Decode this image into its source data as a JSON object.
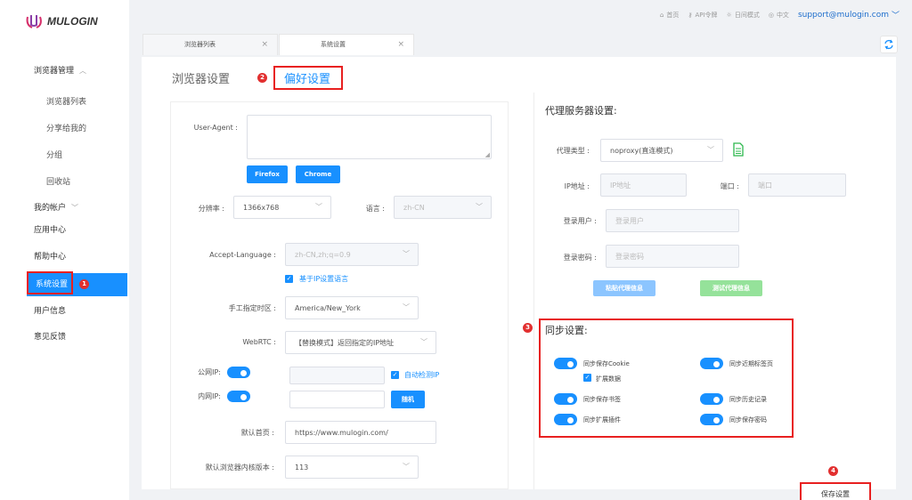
{
  "app": {
    "logo_text": "MULOGIN"
  },
  "topbar": {
    "home": "首页",
    "api": "API令牌",
    "theme": "日间模式",
    "lang": "中文",
    "email": "support@mulogin.com"
  },
  "sidebar": {
    "browser_mgmt": "浏览器管理",
    "browser_list": "浏览器列表",
    "shared": "分享给我的",
    "group": "分组",
    "recycle": "回收站",
    "my_account": "我的帐户",
    "app_center": "应用中心",
    "help_center": "帮助中心",
    "system_settings": "系统设置",
    "user_info": "用户信息",
    "feedback": "意见反馈"
  },
  "tabs": {
    "browser_list": "浏览器列表",
    "system_settings": "系统设置"
  },
  "settings_tabs": {
    "browser_settings": "浏览器设置",
    "preferences": "偏好设置"
  },
  "browser_form": {
    "user_agent_label": "User-Agent :",
    "firefox_btn": "Firefox",
    "chrome_btn": "Chrome",
    "resolution_label": "分辨率 :",
    "resolution_value": "1366x768",
    "language_label": "语言 :",
    "language_value": "zh-CN",
    "accept_lang_label": "Accept-Language :",
    "accept_lang_value": "zh-CN,zh;q=0.9",
    "ip_lang_checkbox": "基于IP设置语言",
    "timezone_label": "手工指定时区 :",
    "timezone_value": "America/New_York",
    "webrtc_label": "WebRTC :",
    "webrtc_value": "【替换模式】返回指定的IP地址",
    "public_ip_label": "公网IP:",
    "auto_detect_ip": "自动检测IP",
    "private_ip_label": "内网IP:",
    "random_btn": "随机",
    "homepage_label": "默认首页 :",
    "homepage_value": "https://www.mulogin.com/",
    "kernel_label": "默认浏览器内核版本 :",
    "kernel_value": "113"
  },
  "proxy": {
    "title": "代理服务器设置:",
    "type_label": "代理类型 :",
    "type_value": "noproxy(直连模式)",
    "ip_label": "IP地址 :",
    "ip_placeholder": "IP地址",
    "port_label": "端口 :",
    "port_placeholder": "端口",
    "user_label": "登录用户 :",
    "user_placeholder": "登录用户",
    "password_label": "登录密码 :",
    "password_placeholder": "登录密码",
    "paste_btn": "粘贴代理信息",
    "test_btn": "测试代理信息"
  },
  "sync": {
    "title": "同步设置:",
    "cookie": "同步保存Cookie",
    "extension_data": "扩展数据",
    "recent_tabs": "同步近期标签页",
    "bookmarks": "同步保存书签",
    "history": "同步历史记录",
    "extensions": "同步扩展插件",
    "passwords": "同步保存密码"
  },
  "save_btn": "保存设置",
  "badges": {
    "b1": "1",
    "b2": "2",
    "b3": "3",
    "b4": "4"
  },
  "colors": {
    "accent": "#1890ff",
    "highlight": "#e82020"
  }
}
